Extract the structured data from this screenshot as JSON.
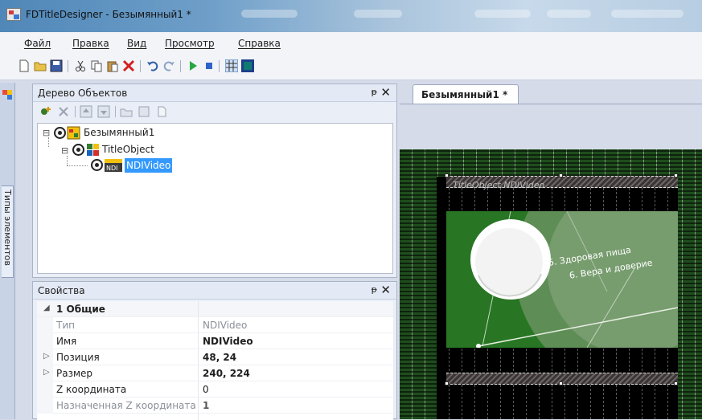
{
  "window": {
    "title": "FDTitleDesigner - Безымянный1 *"
  },
  "menu": {
    "file": "Файл",
    "edit": "Правка",
    "view": "Вид",
    "preview": "Просмотр",
    "help": "Справка"
  },
  "toolbar": {
    "icons": [
      "new-icon",
      "open-icon",
      "save-icon",
      "cut-icon",
      "copy-icon",
      "paste-icon",
      "delete-icon",
      "undo-icon",
      "redo-icon",
      "play-icon",
      "stop-icon",
      "grid-icon",
      "frame-icon"
    ]
  },
  "leftstrip": {
    "tab_label": "Типы элементов"
  },
  "tree_panel": {
    "title": "Дерево Объектов",
    "pin": "ᵽ",
    "close": "✕",
    "nodes": [
      {
        "label": "Безымянный1",
        "expander": "⊟"
      },
      {
        "label": "TitleObject",
        "expander": "⊟"
      },
      {
        "label": "NDIVideo",
        "expander": "",
        "selected": true
      }
    ]
  },
  "props_panel": {
    "title": "Свойства",
    "pin": "ᵽ",
    "close": "✕",
    "category": {
      "name": "1 Общие",
      "expander": "◢"
    },
    "rows": [
      {
        "name": "Тип",
        "value": "NDIVideo",
        "muted": true,
        "bold": false,
        "expander": ""
      },
      {
        "name": "Имя",
        "value": "NDIVideo",
        "muted": false,
        "bold": true,
        "expander": ""
      },
      {
        "name": "Позиция",
        "value": "48, 24",
        "muted": false,
        "bold": true,
        "expander": "▷"
      },
      {
        "name": "Размер",
        "value": "240, 224",
        "muted": false,
        "bold": true,
        "expander": "▷"
      },
      {
        "name": "Z координата",
        "value": "0",
        "muted": false,
        "bold": false,
        "expander": ""
      },
      {
        "name": "Назначенная Z координата",
        "value": "1",
        "muted": true,
        "bold": true,
        "expander": ""
      }
    ]
  },
  "document": {
    "tab_label": "Безымянный1 *",
    "hatch_label": "TitleObject.NDIVideo",
    "captions": [
      "5. Здоровая пища",
      "6. Вера и доверие"
    ]
  },
  "colors": {
    "selection": "#3399ff",
    "canvas_green": "#1f4d1d",
    "accent": "#4f87b8"
  }
}
